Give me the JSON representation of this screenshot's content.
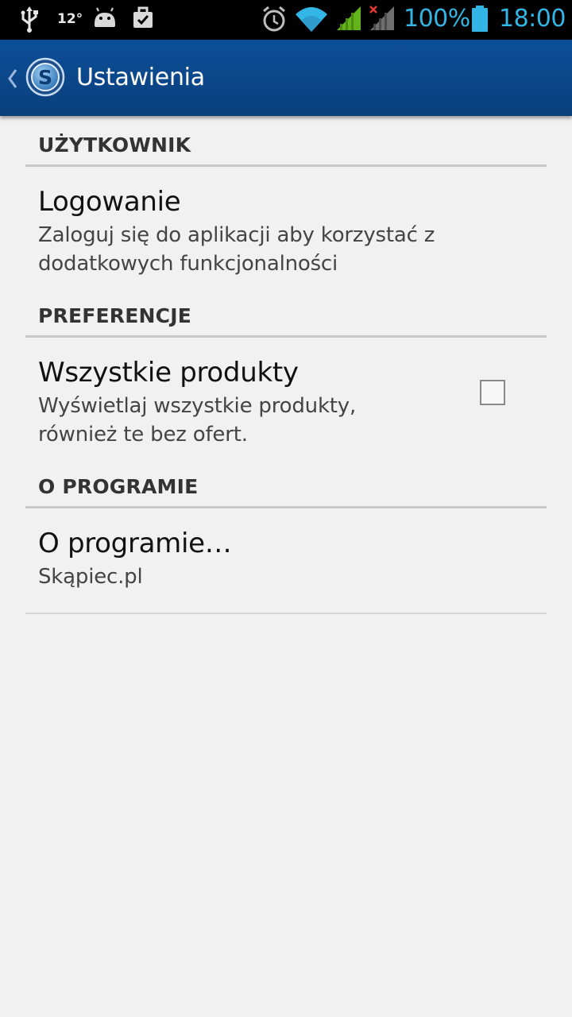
{
  "status_bar": {
    "temperature": "12°",
    "battery_percent": "100%",
    "time": "18:00",
    "icons": [
      "usb-icon",
      "android-icon",
      "briefcase-icon",
      "alarm-icon",
      "wifi-icon",
      "signal-icon",
      "signal-no-service-icon",
      "battery-icon"
    ],
    "accent_color": "#33b5e5",
    "signal_color": "#63b31a"
  },
  "action_bar": {
    "title": "Ustawienia",
    "logo_letter": "S",
    "background_color": "#0c4f98"
  },
  "preferences": {
    "user_category": "UŻYTKOWNIK",
    "login": {
      "title": "Logowanie",
      "summary": "Zaloguj się do aplikacji aby korzystać z dodatkowych funkcjonalności"
    },
    "preferences_category": "PREFERENCJE",
    "all_products": {
      "title": "Wszystkie produkty",
      "summary": "Wyświetlaj wszystkie produkty, również te bez ofert.",
      "checked": false
    },
    "about_category": "O PROGRAMIE",
    "about": {
      "title": "O programie…",
      "summary": "Skąpiec.pl"
    }
  }
}
